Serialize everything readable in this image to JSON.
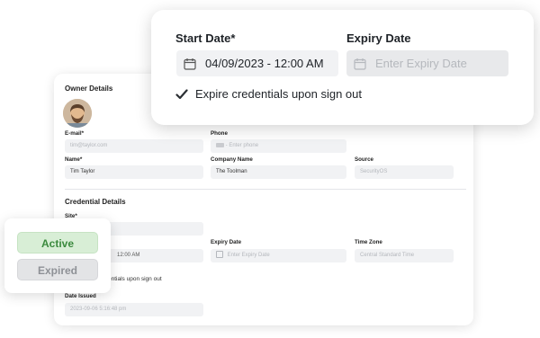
{
  "owner": {
    "section_title": "Owner Details",
    "email_label": "E-mail*",
    "email_placeholder": "tim@taylor.com",
    "phone_label": "Phone",
    "phone_placeholder": "Enter phone",
    "name_label": "Name*",
    "name_value": "Tim Taylor",
    "company_label": "Company Name",
    "company_value": "The Toolman",
    "source_label": "Source",
    "source_value": "SecurityOS"
  },
  "credential": {
    "section_title": "Credential Details",
    "site_label": "Site*",
    "start_partial": "12:00 AM",
    "expiry_label": "Expiry Date",
    "expiry_placeholder": "Enter Expiry Date",
    "timezone_label": "Time Zone",
    "timezone_value": "Central Standard Time",
    "expire_partial": "entials upon sign out",
    "date_issued_label": "Date Issued",
    "date_issued_value": "2023-09-06 5:16:48 pm"
  },
  "popover": {
    "start_label": "Start Date*",
    "start_value": "04/09/2023 - 12:00 AM",
    "expiry_label": "Expiry Date",
    "expiry_placeholder": "Enter Expiry Date",
    "expire_checkbox_label": "Expire credentials upon sign out",
    "expire_checked": true
  },
  "status": {
    "active_label": "Active",
    "expired_label": "Expired",
    "colors": {
      "active_bg": "#d8eed6",
      "active_text": "#3b8a3e",
      "expired_bg": "#e3e4e6",
      "expired_text": "#8e9196"
    }
  }
}
